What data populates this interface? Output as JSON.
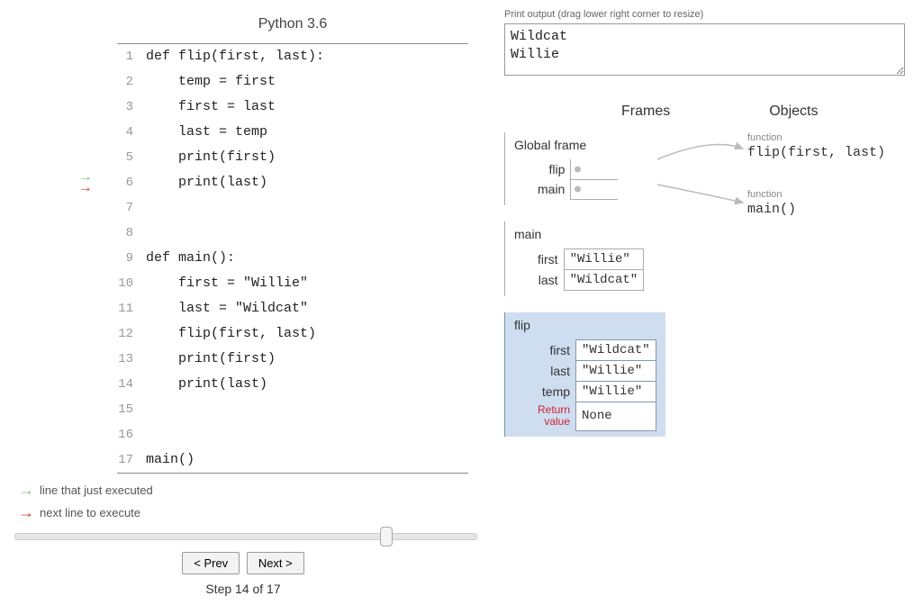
{
  "title": "Python 3.6",
  "code": {
    "lines": [
      {
        "n": 1,
        "text": "def flip(first, last):"
      },
      {
        "n": 2,
        "text": "    temp = first"
      },
      {
        "n": 3,
        "text": "    first = last"
      },
      {
        "n": 4,
        "text": "    last = temp"
      },
      {
        "n": 5,
        "text": "    print(first)"
      },
      {
        "n": 6,
        "text": "    print(last)"
      },
      {
        "n": 7,
        "text": ""
      },
      {
        "n": 8,
        "text": ""
      },
      {
        "n": 9,
        "text": "def main():"
      },
      {
        "n": 10,
        "text": "    first = \"Willie\""
      },
      {
        "n": 11,
        "text": "    last = \"Wildcat\""
      },
      {
        "n": 12,
        "text": "    flip(first, last)"
      },
      {
        "n": 13,
        "text": "    print(first)"
      },
      {
        "n": 14,
        "text": "    print(last)"
      },
      {
        "n": 15,
        "text": ""
      },
      {
        "n": 16,
        "text": ""
      },
      {
        "n": 17,
        "text": "main()"
      }
    ],
    "just_executed_line": 6,
    "next_line": 6
  },
  "legend": {
    "just_executed": "line that just executed",
    "next_line": "next line to execute"
  },
  "controls": {
    "prev": "< Prev",
    "next": "Next >",
    "step_label": "Step 14 of 17",
    "current_step": 14,
    "total_steps": 17
  },
  "print_output": {
    "label": "Print output (drag lower right corner to resize)",
    "value": "Wildcat\nWillie"
  },
  "headers": {
    "frames": "Frames",
    "objects": "Objects"
  },
  "frames": {
    "global": {
      "title": "Global frame",
      "vars": [
        {
          "name": "flip",
          "pointer": true
        },
        {
          "name": "main",
          "pointer": true
        }
      ]
    },
    "main": {
      "title": "main",
      "vars": [
        {
          "name": "first",
          "value": "\"Willie\""
        },
        {
          "name": "last",
          "value": "\"Wildcat\""
        }
      ]
    },
    "flip": {
      "title": "flip",
      "highlighted": true,
      "vars": [
        {
          "name": "first",
          "value": "\"Wildcat\""
        },
        {
          "name": "last",
          "value": "\"Willie\""
        },
        {
          "name": "temp",
          "value": "\"Willie\""
        }
      ],
      "return_label": "Return\nvalue",
      "return_value": "None"
    }
  },
  "objects": [
    {
      "type_label": "function",
      "repr": "flip(first, last)"
    },
    {
      "type_label": "function",
      "repr": "main()"
    }
  ]
}
